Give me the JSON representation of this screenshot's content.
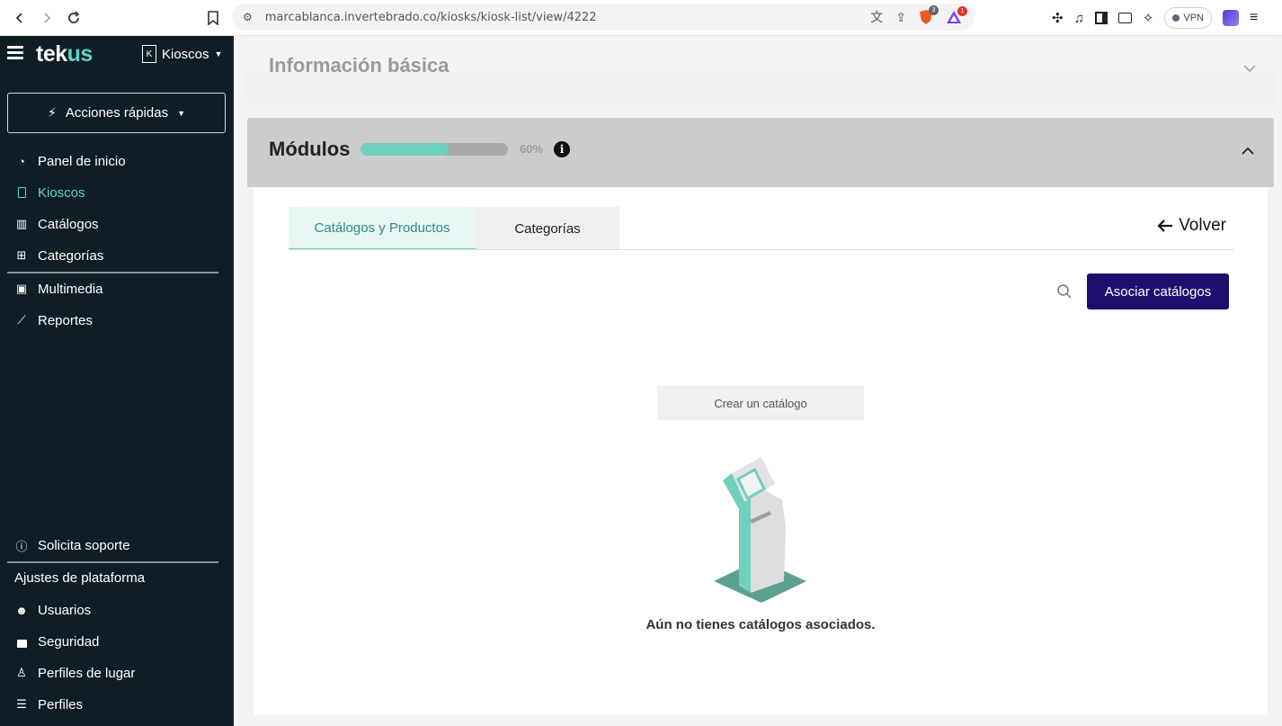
{
  "browser": {
    "url": "marcablanca.invertebrado.co/kiosks/kiosk-list/view/4222",
    "vpn_label": "VPN",
    "brave_badge": "3",
    "rewards_badge": "1"
  },
  "sidebar": {
    "logo_main": "tek",
    "logo_accent": "us",
    "kiosk_switch_label": "Kioscos",
    "kiosk_letter": "K",
    "quick_actions": "Acciones rápidas",
    "items": [
      {
        "label": "Panel de inicio",
        "icon": "dashboard-icon"
      },
      {
        "label": "Kioscos",
        "icon": "kiosk-icon"
      },
      {
        "label": "Catálogos",
        "icon": "book-icon"
      },
      {
        "label": "Categorías",
        "icon": "category-icon"
      },
      {
        "label": "Multimedia",
        "icon": "media-icon"
      },
      {
        "label": "Reportes",
        "icon": "chart-icon"
      }
    ],
    "support": "Solicita soporte",
    "settings_title": "Ajustes de plataforma",
    "settings_items": [
      {
        "label": "Usuarios",
        "icon": "users-icon"
      },
      {
        "label": "Seguridad",
        "icon": "lock-icon"
      },
      {
        "label": "Perfiles de lugar",
        "icon": "place-profile-icon"
      },
      {
        "label": "Perfiles",
        "icon": "profiles-icon"
      }
    ]
  },
  "main": {
    "info_title": "Información básica",
    "modules_title": "Módulos",
    "progress_percent": 60,
    "progress_label": "60%",
    "tabs": [
      {
        "label": "Catálogos y Productos",
        "active": true
      },
      {
        "label": "Categorías",
        "active": false
      }
    ],
    "back_label": "Volver",
    "associate_button": "Asociar catálogos",
    "create_button": "Crear un catálogo",
    "empty_message": "Aún no tienes catálogos asociados."
  },
  "colors": {
    "sidebar_bg": "#0f1d27",
    "accent": "#5dd6c0",
    "primary_button": "#1e0f6e"
  }
}
